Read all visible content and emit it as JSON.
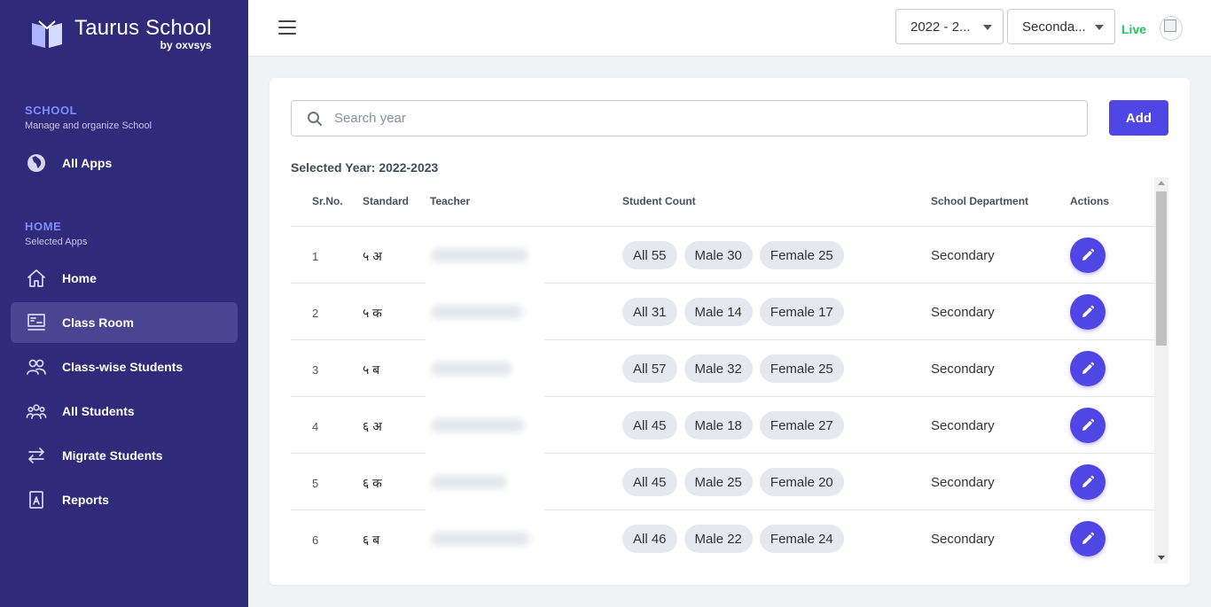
{
  "brand": {
    "name": "Taurus School",
    "by": "by oxvsys"
  },
  "sidebar": {
    "school_section": {
      "title": "SCHOOL",
      "subtitle": "Manage and organize School"
    },
    "school_items": [
      {
        "label": "All Apps",
        "icon": "globe-icon"
      }
    ],
    "home_section": {
      "title": "HOME",
      "subtitle": "Selected Apps"
    },
    "home_items": [
      {
        "label": "Home",
        "icon": "home-icon"
      },
      {
        "label": "Class Room",
        "icon": "classroom-icon",
        "active": true
      },
      {
        "label": "Class-wise Students",
        "icon": "users-icon"
      },
      {
        "label": "All Students",
        "icon": "group-icon"
      },
      {
        "label": "Migrate Students",
        "icon": "arrows-swap-icon"
      },
      {
        "label": "Reports",
        "icon": "report-icon"
      }
    ]
  },
  "topbar": {
    "year_select": "2022 - 2...",
    "dept_select": "Seconda...",
    "status": "Live"
  },
  "main": {
    "search_placeholder": "Search year",
    "add_label": "Add",
    "selected_year": "Selected Year: 2022-2023",
    "columns": [
      "Sr.No.",
      "Standard",
      "Teacher",
      "Student Count",
      "School Department",
      "Actions"
    ],
    "rows": [
      {
        "sr": "1",
        "standard": "५ अ",
        "all": "All 55",
        "male": "Male 30",
        "female": "Female 25",
        "dept": "Secondary"
      },
      {
        "sr": "2",
        "standard": "५ क",
        "all": "All 31",
        "male": "Male 14",
        "female": "Female 17",
        "dept": "Secondary"
      },
      {
        "sr": "3",
        "standard": "५ ब",
        "all": "All 57",
        "male": "Male 32",
        "female": "Female 25",
        "dept": "Secondary"
      },
      {
        "sr": "4",
        "standard": "६ अ",
        "all": "All 45",
        "male": "Male 18",
        "female": "Female 27",
        "dept": "Secondary"
      },
      {
        "sr": "5",
        "standard": "६ क",
        "all": "All 45",
        "male": "Male 25",
        "female": "Female 20",
        "dept": "Secondary"
      },
      {
        "sr": "6",
        "standard": "६ ब",
        "all": "All 46",
        "male": "Male 22",
        "female": "Female 24",
        "dept": "Secondary"
      }
    ]
  },
  "colors": {
    "sidebar": "#2f2a7a",
    "accent": "#4f46e5",
    "live": "#22c55e"
  }
}
